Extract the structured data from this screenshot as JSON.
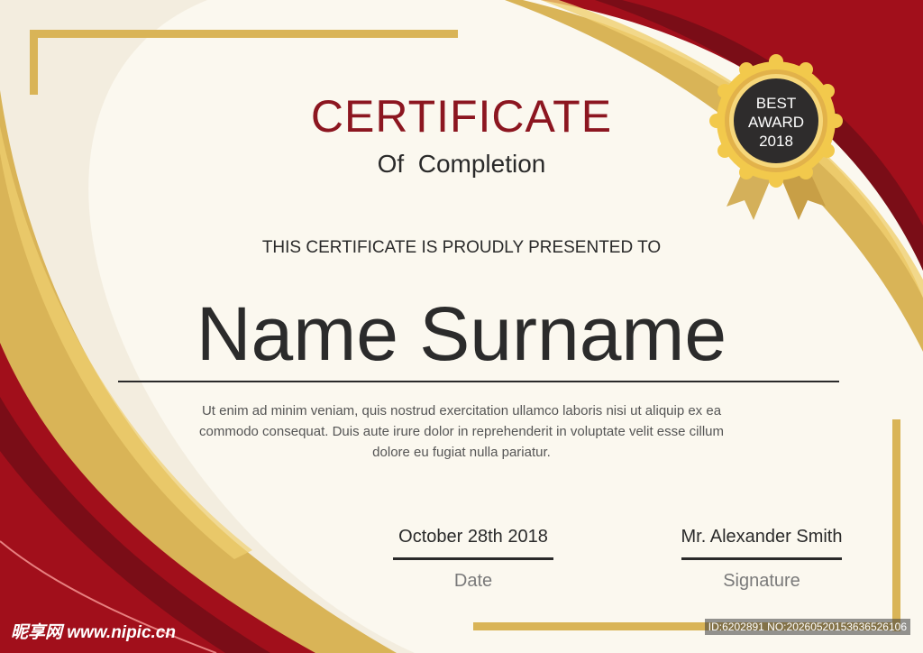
{
  "certificate": {
    "title": "CERTIFICATE",
    "subtitle": "Of  Completion",
    "presented_to": "THIS CERTIFICATE IS PROUDLY PRESENTED TO",
    "recipient_name": "Name Surname",
    "body_text": "Ut enim ad minim veniam, quis nostrud exercitation ullamco laboris nisi ut aliquip ex ea commodo consequat. Duis aute irure dolor in reprehenderit in voluptate velit esse cillum dolore eu fugiat nulla pariatur.",
    "date_value": "October 28th 2018",
    "date_label": "Date",
    "signer_name": "Mr. Alexander Smith",
    "signature_label": "Signature"
  },
  "badge": {
    "line1": "BEST",
    "line2": "AWARD",
    "line3": "2018"
  },
  "watermark": {
    "site": "昵享网 www.nipic.cn",
    "id": "ID:6202891 NO:20260520153636526106"
  },
  "colors": {
    "background": "#fbf8ef",
    "red": "#a10f1b",
    "dark_red": "#7a0d17",
    "gold": "#d9b457",
    "light_gold": "#f0d070",
    "title_red": "#8c1620"
  }
}
